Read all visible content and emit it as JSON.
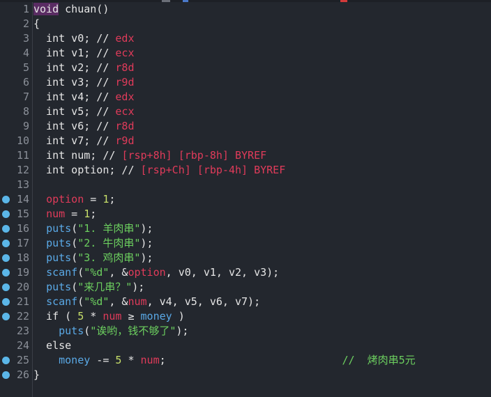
{
  "editor": {
    "lines": [
      {
        "n": "1",
        "bp": false,
        "caret": true,
        "tokens": [
          [
            "kw-void",
            "void"
          ],
          [
            "t-id",
            " chuan()"
          ]
        ]
      },
      {
        "n": "2",
        "bp": false,
        "tokens": [
          [
            "t-op",
            "{"
          ]
        ]
      },
      {
        "n": "3",
        "bp": false,
        "tokens": [
          [
            "t-kw",
            "  int v0; // "
          ],
          [
            "t-reg",
            "edx"
          ]
        ]
      },
      {
        "n": "4",
        "bp": false,
        "tokens": [
          [
            "t-kw",
            "  int v1; // "
          ],
          [
            "t-reg",
            "ecx"
          ]
        ]
      },
      {
        "n": "5",
        "bp": false,
        "tokens": [
          [
            "t-kw",
            "  int v2; // "
          ],
          [
            "t-reg",
            "r8d"
          ]
        ]
      },
      {
        "n": "6",
        "bp": false,
        "tokens": [
          [
            "t-kw",
            "  int v3; // "
          ],
          [
            "t-reg",
            "r9d"
          ]
        ]
      },
      {
        "n": "7",
        "bp": false,
        "tokens": [
          [
            "t-kw",
            "  int v4; // "
          ],
          [
            "t-reg",
            "edx"
          ]
        ]
      },
      {
        "n": "8",
        "bp": false,
        "tokens": [
          [
            "t-kw",
            "  int v5; // "
          ],
          [
            "t-reg",
            "ecx"
          ]
        ]
      },
      {
        "n": "9",
        "bp": false,
        "tokens": [
          [
            "t-kw",
            "  int v6; // "
          ],
          [
            "t-reg",
            "r8d"
          ]
        ]
      },
      {
        "n": "10",
        "bp": false,
        "tokens": [
          [
            "t-kw",
            "  int v7; // "
          ],
          [
            "t-reg",
            "r9d"
          ]
        ]
      },
      {
        "n": "11",
        "bp": false,
        "tokens": [
          [
            "t-kw",
            "  int num; // "
          ],
          [
            "t-reg",
            "[rsp+8h] [rbp-8h] BYREF"
          ]
        ]
      },
      {
        "n": "12",
        "bp": false,
        "tokens": [
          [
            "t-kw",
            "  int option; // "
          ],
          [
            "t-reg",
            "[rsp+Ch] [rbp-4h] BYREF"
          ]
        ]
      },
      {
        "n": "13",
        "bp": false,
        "tokens": [
          [
            "t-op",
            ""
          ]
        ]
      },
      {
        "n": "14",
        "bp": true,
        "tokens": [
          [
            "t-op",
            "  "
          ],
          [
            "t-local",
            "option"
          ],
          [
            "t-op",
            " = "
          ],
          [
            "t-num",
            "1"
          ],
          [
            "t-op",
            ";"
          ]
        ]
      },
      {
        "n": "15",
        "bp": true,
        "tokens": [
          [
            "t-op",
            "  "
          ],
          [
            "t-local",
            "num"
          ],
          [
            "t-op",
            " = "
          ],
          [
            "t-num",
            "1"
          ],
          [
            "t-op",
            ";"
          ]
        ]
      },
      {
        "n": "16",
        "bp": true,
        "tokens": [
          [
            "t-op",
            "  "
          ],
          [
            "t-func",
            "puts"
          ],
          [
            "t-op",
            "("
          ],
          [
            "t-str",
            "\"1. 羊肉串\""
          ],
          [
            "t-op",
            ");"
          ]
        ]
      },
      {
        "n": "17",
        "bp": true,
        "tokens": [
          [
            "t-op",
            "  "
          ],
          [
            "t-func",
            "puts"
          ],
          [
            "t-op",
            "("
          ],
          [
            "t-str",
            "\"2. 牛肉串\""
          ],
          [
            "t-op",
            ");"
          ]
        ]
      },
      {
        "n": "18",
        "bp": true,
        "tokens": [
          [
            "t-op",
            "  "
          ],
          [
            "t-func",
            "puts"
          ],
          [
            "t-op",
            "("
          ],
          [
            "t-str",
            "\"3. 鸡肉串\""
          ],
          [
            "t-op",
            ");"
          ]
        ]
      },
      {
        "n": "19",
        "bp": true,
        "tokens": [
          [
            "t-op",
            "  "
          ],
          [
            "t-func",
            "scanf"
          ],
          [
            "t-op",
            "("
          ],
          [
            "t-str",
            "\"%d\""
          ],
          [
            "t-op",
            ", &"
          ],
          [
            "t-local",
            "option"
          ],
          [
            "t-op",
            ", v0, v1, v2, v3);"
          ]
        ]
      },
      {
        "n": "20",
        "bp": true,
        "tokens": [
          [
            "t-op",
            "  "
          ],
          [
            "t-func",
            "puts"
          ],
          [
            "t-op",
            "("
          ],
          [
            "t-str",
            "\"来几串？\""
          ],
          [
            "t-op",
            ");"
          ]
        ]
      },
      {
        "n": "21",
        "bp": true,
        "tokens": [
          [
            "t-op",
            "  "
          ],
          [
            "t-func",
            "scanf"
          ],
          [
            "t-op",
            "("
          ],
          [
            "t-str",
            "\"%d\""
          ],
          [
            "t-op",
            ", &"
          ],
          [
            "t-local",
            "num"
          ],
          [
            "t-op",
            ", v4, v5, v6, v7);"
          ]
        ]
      },
      {
        "n": "22",
        "bp": true,
        "tokens": [
          [
            "t-op",
            "  if ( "
          ],
          [
            "t-num",
            "5"
          ],
          [
            "t-op",
            " * "
          ],
          [
            "t-local",
            "num"
          ],
          [
            "t-op",
            " ≥ "
          ],
          [
            "t-glob",
            "money"
          ],
          [
            "t-op",
            " )"
          ]
        ]
      },
      {
        "n": "23",
        "bp": false,
        "tokens": [
          [
            "t-op",
            "    "
          ],
          [
            "t-func",
            "puts"
          ],
          [
            "t-op",
            "("
          ],
          [
            "t-str",
            "\"诶哟，钱不够了\""
          ],
          [
            "t-op",
            ");"
          ]
        ]
      },
      {
        "n": "24",
        "bp": false,
        "tokens": [
          [
            "t-op",
            "  else"
          ]
        ]
      },
      {
        "n": "25",
        "bp": true,
        "tokens": [
          [
            "t-op",
            "    "
          ],
          [
            "t-glob",
            "money"
          ],
          [
            "t-op",
            " -= "
          ],
          [
            "t-num",
            "5"
          ],
          [
            "t-op",
            " * "
          ],
          [
            "t-local",
            "num"
          ],
          [
            "t-op",
            ";"
          ],
          [
            "t-op",
            "                            "
          ],
          [
            "t-green-cmt",
            "//  烤肉串5元"
          ]
        ]
      },
      {
        "n": "26",
        "bp": true,
        "tokens": [
          [
            "t-op",
            "}"
          ]
        ]
      }
    ]
  }
}
